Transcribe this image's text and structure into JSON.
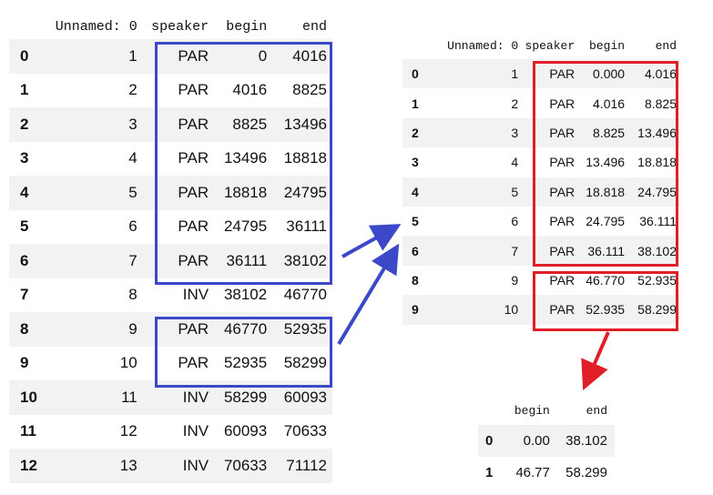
{
  "left_table": {
    "columns": [
      "",
      "Unnamed: 0",
      "speaker",
      "begin",
      "end"
    ],
    "rows": [
      [
        "0",
        "1",
        "PAR",
        "0",
        "4016"
      ],
      [
        "1",
        "2",
        "PAR",
        "4016",
        "8825"
      ],
      [
        "2",
        "3",
        "PAR",
        "8825",
        "13496"
      ],
      [
        "3",
        "4",
        "PAR",
        "13496",
        "18818"
      ],
      [
        "4",
        "5",
        "PAR",
        "18818",
        "24795"
      ],
      [
        "5",
        "6",
        "PAR",
        "24795",
        "36111"
      ],
      [
        "6",
        "7",
        "PAR",
        "36111",
        "38102"
      ],
      [
        "7",
        "8",
        "INV",
        "38102",
        "46770"
      ],
      [
        "8",
        "9",
        "PAR",
        "46770",
        "52935"
      ],
      [
        "9",
        "10",
        "PAR",
        "52935",
        "58299"
      ],
      [
        "10",
        "11",
        "INV",
        "58299",
        "60093"
      ],
      [
        "11",
        "12",
        "INV",
        "60093",
        "70633"
      ],
      [
        "12",
        "13",
        "INV",
        "70633",
        "71112"
      ]
    ]
  },
  "right_table": {
    "columns": [
      "",
      "Unnamed: 0",
      "speaker",
      "begin",
      "end"
    ],
    "rows": [
      [
        "0",
        "1",
        "PAR",
        "0.000",
        "4.016"
      ],
      [
        "1",
        "2",
        "PAR",
        "4.016",
        "8.825"
      ],
      [
        "2",
        "3",
        "PAR",
        "8.825",
        "13.496"
      ],
      [
        "3",
        "4",
        "PAR",
        "13.496",
        "18.818"
      ],
      [
        "4",
        "5",
        "PAR",
        "18.818",
        "24.795"
      ],
      [
        "5",
        "6",
        "PAR",
        "24.795",
        "36.111"
      ],
      [
        "6",
        "7",
        "PAR",
        "36.111",
        "38.102"
      ],
      [
        "8",
        "9",
        "PAR",
        "46.770",
        "52.935"
      ],
      [
        "9",
        "10",
        "PAR",
        "52.935",
        "58.299"
      ]
    ]
  },
  "bottom_table": {
    "columns": [
      "",
      "begin",
      "end"
    ],
    "rows": [
      [
        "0",
        "0.00",
        "38.102"
      ],
      [
        "1",
        "46.77",
        "58.299"
      ]
    ]
  },
  "colors": {
    "highlight_blue": "#3b48c8",
    "highlight_red": "#e01e28",
    "row_stripe": "#f2f2f2"
  }
}
